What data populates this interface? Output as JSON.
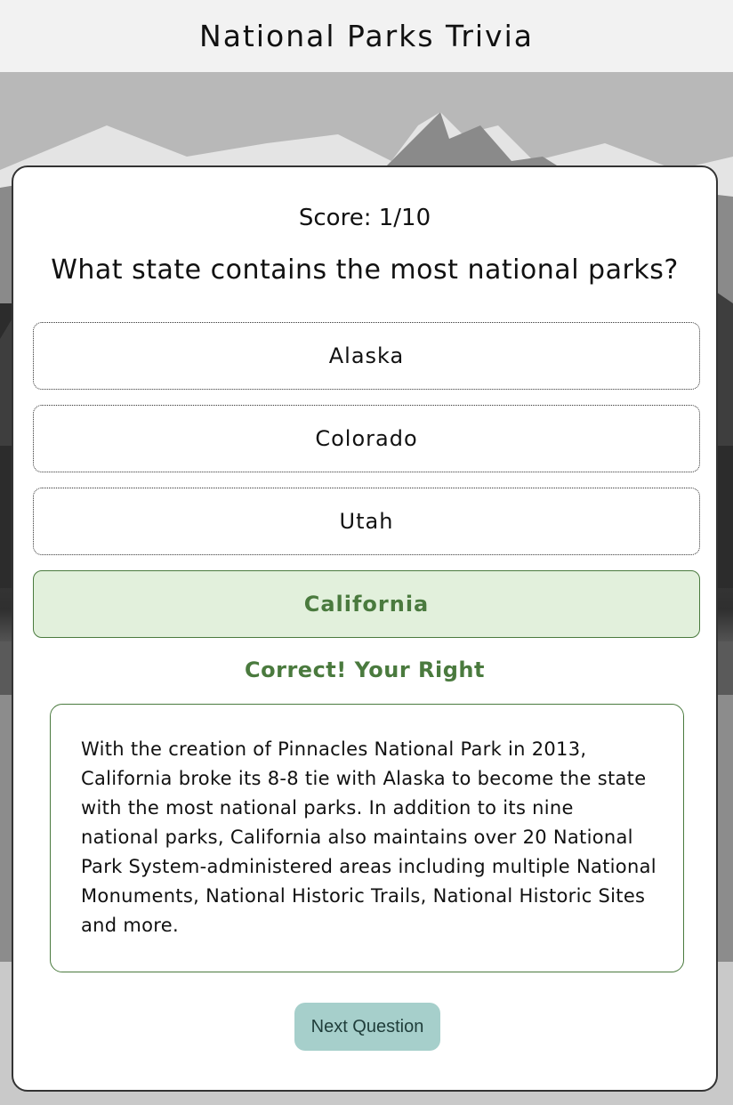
{
  "header": {
    "title": "National Parks Trivia"
  },
  "quiz": {
    "score": "Score: 1/10",
    "question": "What state contains the most national parks?",
    "answers": [
      {
        "label": "Alaska",
        "state": "default"
      },
      {
        "label": "Colorado",
        "state": "default"
      },
      {
        "label": "Utah",
        "state": "default"
      },
      {
        "label": "California",
        "state": "correct"
      }
    ],
    "feedback": "Correct! Your Right",
    "explanation": "With the creation of Pinnacles National Park in 2013, California broke its 8-8 tie with Alaska to become the state with the most national parks. In addition to its nine national parks, California also maintains over 20 National Park System-administered areas including multiple National Monuments, National Historic Trails, National Historic Sites and more.",
    "next_label": "Next Question"
  },
  "colors": {
    "header_bg": "#f2f2f2",
    "correct_green": "#4a7a3e",
    "correct_bg": "#e2f0dc",
    "next_button_bg": "#a6cfcb"
  }
}
